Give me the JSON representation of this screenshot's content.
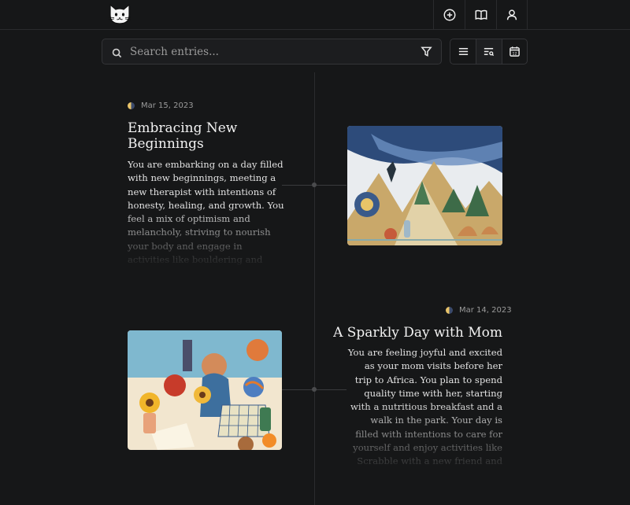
{
  "header": {
    "logo": "cat-logo",
    "buttons": [
      {
        "icon": "plus-circle-icon",
        "label": "New entry"
      },
      {
        "icon": "book-icon",
        "label": "Journal"
      },
      {
        "icon": "user-icon",
        "label": "Profile"
      }
    ]
  },
  "search": {
    "placeholder": "Search entries...",
    "value": ""
  },
  "view_options": [
    "list-view-icon",
    "list-search-view-icon",
    "calendar-view-icon"
  ],
  "entries": [
    {
      "date": "Mar 15, 2023",
      "title": "Embracing New Beginnings",
      "body": "You are embarking on a day filled with new beginnings, meeting a new therapist with intentions of honesty, healing, and growth. You feel a mix of optimism and melancholy, striving to nourish your body and engage in activities like bouldering and yoga. You're also focused on catching up",
      "moon_phase": "first-quarter"
    },
    {
      "date": "Mar 14, 2023",
      "title": "A Sparkly Day with Mom",
      "body": "You are feeling joyful and excited as your mom visits before her trip to Africa. You plan to spend quality time with her, starting with a nutritious breakfast and a walk in the park. Your day is filled with intentions to care for yourself and enjoy activities like Scrabble with a new friend and possibly juggling. You're focused on",
      "moon_phase": "first-quarter"
    }
  ],
  "colors": {
    "background": "#161718",
    "border": "#2a2b2d",
    "text": "#e8e8e8",
    "muted": "#9a9a9a"
  }
}
